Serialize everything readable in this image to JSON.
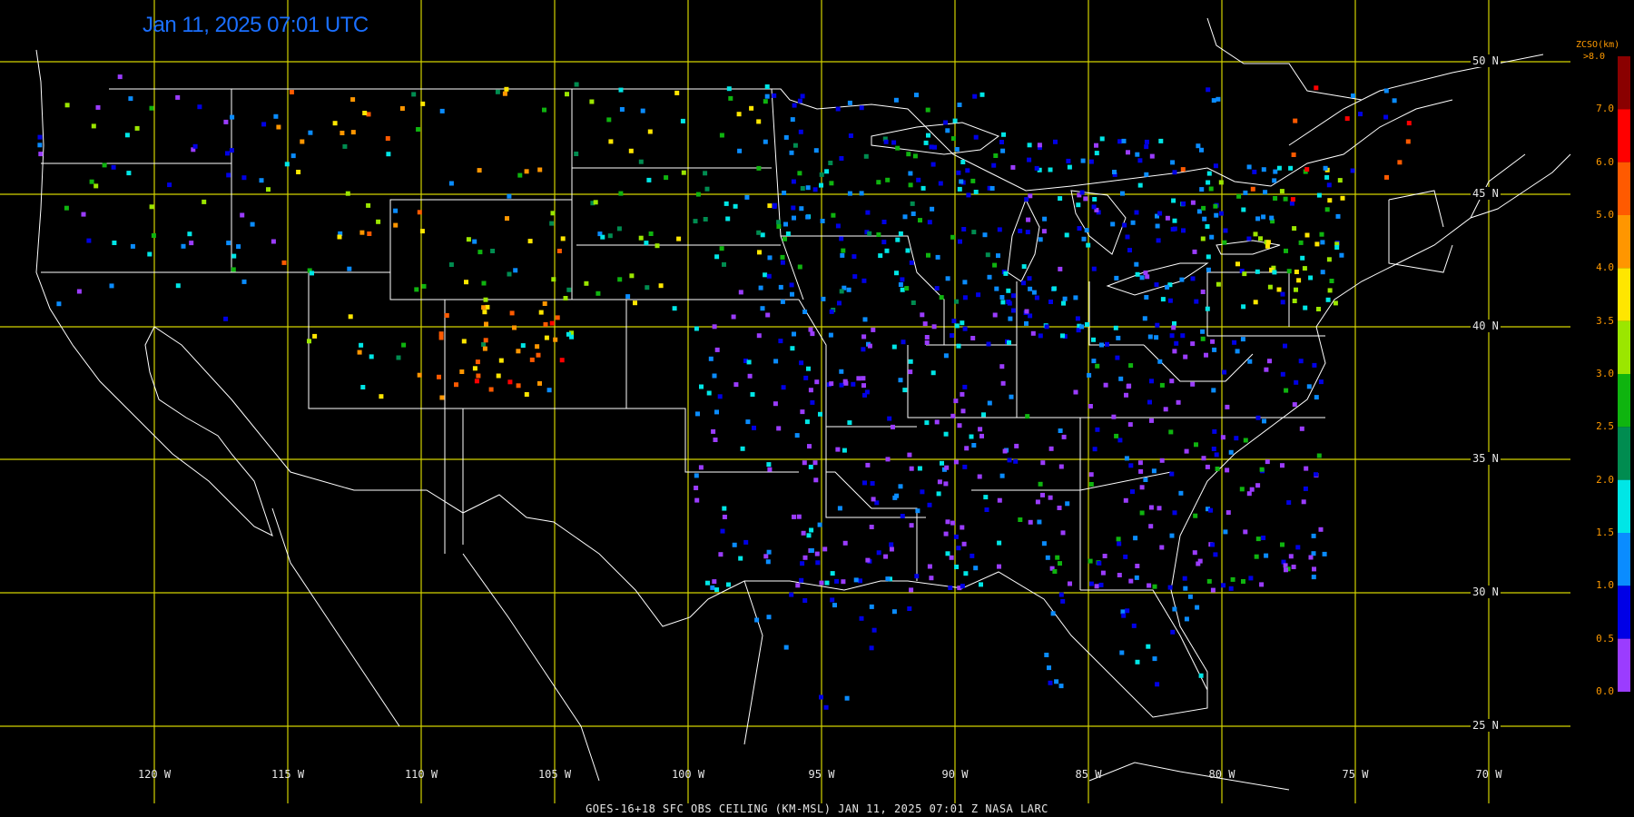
{
  "timestamp": "Jan 11, 2025 07:01 UTC",
  "footer": "GOES-16+18  SFC OBS CEILING (KM-MSL)  JAN 11, 2025 07:01 Z  NASA LARC",
  "legend": {
    "title": "ZCSO(km)",
    "top_label": ">8.0",
    "labels": [
      "7.0",
      "6.0",
      "5.0",
      "4.0",
      "3.5",
      "3.0",
      "2.5",
      "2.0",
      "1.5",
      "1.0",
      "0.5",
      "0.0"
    ],
    "colors": [
      "#8a0000",
      "#ff0000",
      "#ff5a00",
      "#ff9600",
      "#ffe600",
      "#9be600",
      "#0fb40f",
      "#008c50",
      "#00e6e6",
      "#0a8cff",
      "#0000e6",
      "#9b3cff"
    ]
  },
  "lon_labels": [
    "120 W",
    "115 W",
    "110 W",
    "105 W",
    "100 W",
    "95 W",
    "90 W",
    "85 W",
    "80 W",
    "75 W",
    "70 W"
  ],
  "lat_labels": [
    "50 N",
    "45 N",
    "40 N",
    "35 N",
    "30 N",
    "25 N"
  ],
  "colors": {
    "grid": "#d2d200",
    "border": "#ffffff",
    "timestamp": "#1a6fff",
    "label": "#e6e6e6"
  }
}
